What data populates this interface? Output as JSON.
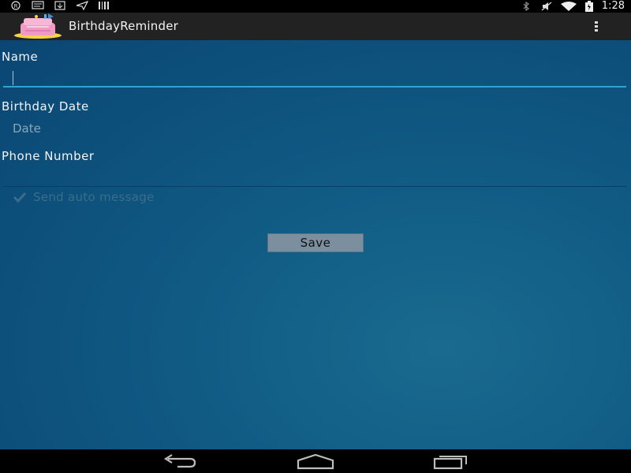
{
  "status_bar": {
    "time": "1:28"
  },
  "action_bar": {
    "app_title": "BirthdayReminder",
    "overflow_icon": "overflow-menu-icon"
  },
  "form": {
    "name_label": "Name",
    "name_value": "",
    "birthday_label": "Birthday Date",
    "birthday_placeholder": "Date",
    "phone_label": "Phone Number",
    "phone_value": "",
    "auto_message_label": "Send auto message",
    "auto_message_checked": true,
    "save_label": "Save"
  },
  "colors": {
    "background": "#0d507c",
    "action_bar": "#222222",
    "accent": "#33b5e5"
  }
}
